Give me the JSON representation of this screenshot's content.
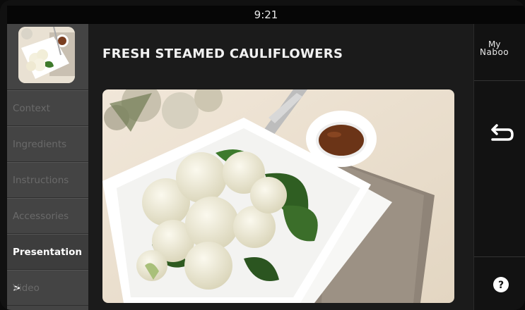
{
  "status": {
    "time": "9:21"
  },
  "recipe": {
    "title": "FRESH STEAMED CAULIFLOWERS"
  },
  "nav": {
    "items": [
      {
        "label": "Context",
        "active": false
      },
      {
        "label": "Ingredients",
        "active": false
      },
      {
        "label": "Instructions",
        "active": false
      },
      {
        "label": "Accessories",
        "active": false
      },
      {
        "label": "Presentation >",
        "active": true
      },
      {
        "label": "Video",
        "active": false
      }
    ]
  },
  "brand": {
    "line1": "My",
    "line2": "Naboo"
  },
  "icons": {
    "back": "back-arrow-icon",
    "help": "help-icon"
  },
  "colors": {
    "active_text": "#ffffff",
    "inactive_text": "#6a6a6a",
    "sidebar_bg": "#444444"
  }
}
